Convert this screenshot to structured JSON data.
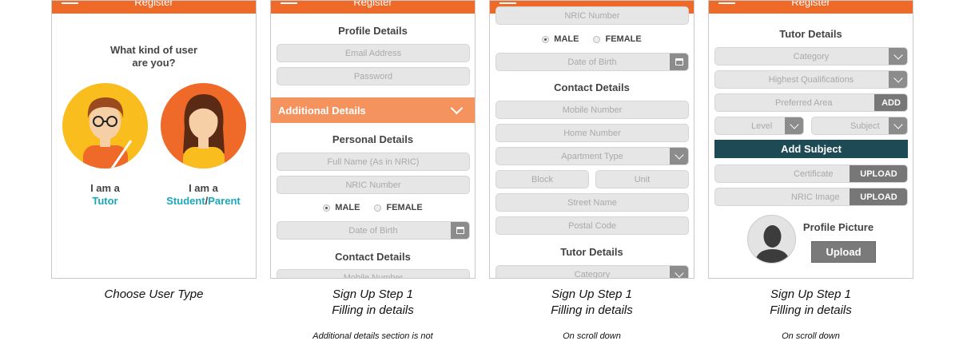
{
  "app": {
    "title": "Register"
  },
  "screen1": {
    "question_line1": "What kind of user",
    "question_line2": "are you?",
    "tutor_prefix": "I am a",
    "tutor_role": "Tutor",
    "student_prefix": "I am a",
    "student_role": "Student",
    "slash": "/",
    "parent_role": "Parent"
  },
  "screen2": {
    "profile_heading": "Profile Details",
    "email_placeholder": "Email Address",
    "password_placeholder": "Password",
    "additional_label": "Additional Details",
    "personal_heading": "Personal Details",
    "fullname_placeholder": "Full Name (As in NRIC)",
    "nric_placeholder": "NRIC Number",
    "male": "MALE",
    "female": "FEMALE",
    "dob_placeholder": "Date of Birth",
    "contact_heading": "Contact Details",
    "mobile_placeholder": "Mobile Number"
  },
  "screen3": {
    "nric_placeholder": "NRIC Number",
    "male": "MALE",
    "female": "FEMALE",
    "dob_placeholder": "Date of Birth",
    "contact_heading": "Contact Details",
    "mobile_placeholder": "Mobile Number",
    "home_placeholder": "Home Number",
    "apartment_placeholder": "Apartment Type",
    "block_placeholder": "Block",
    "unit_placeholder": "Unit",
    "street_placeholder": "Street Name",
    "postal_placeholder": "Postal Code",
    "tutor_heading": "Tutor Details",
    "category_placeholder": "Category"
  },
  "screen4": {
    "tutor_heading": "Tutor Details",
    "category_placeholder": "Category",
    "qualifications_placeholder": "Highest Qualifications",
    "area_placeholder": "Preferred Area",
    "add_label": "ADD",
    "level_placeholder": "Level",
    "subject_placeholder": "Subject",
    "add_subject_label": "Add Subject",
    "certificate_placeholder": "Certificate",
    "nric_image_placeholder": "NRIC Image",
    "upload_label": "UPLOAD",
    "profile_picture_label": "Profile Picture",
    "upload_button": "Upload"
  },
  "captions": {
    "c1": "Choose User Type",
    "c2_line1": "Sign Up Step 1",
    "c2_line2": "Filling in details",
    "c3_line1": "Sign Up Step 1",
    "c3_line2": "Filling in details",
    "c4_line1": "Sign Up Step 1",
    "c4_line2": "Filling in details",
    "n2": "Additional details section is not",
    "n3": "On scroll down",
    "n4": "On scroll down"
  },
  "colors": {
    "brand": "#ef6a28",
    "accent": "#1aa8b8",
    "section": "#f4935e",
    "dark_button": "#1d4a55"
  }
}
